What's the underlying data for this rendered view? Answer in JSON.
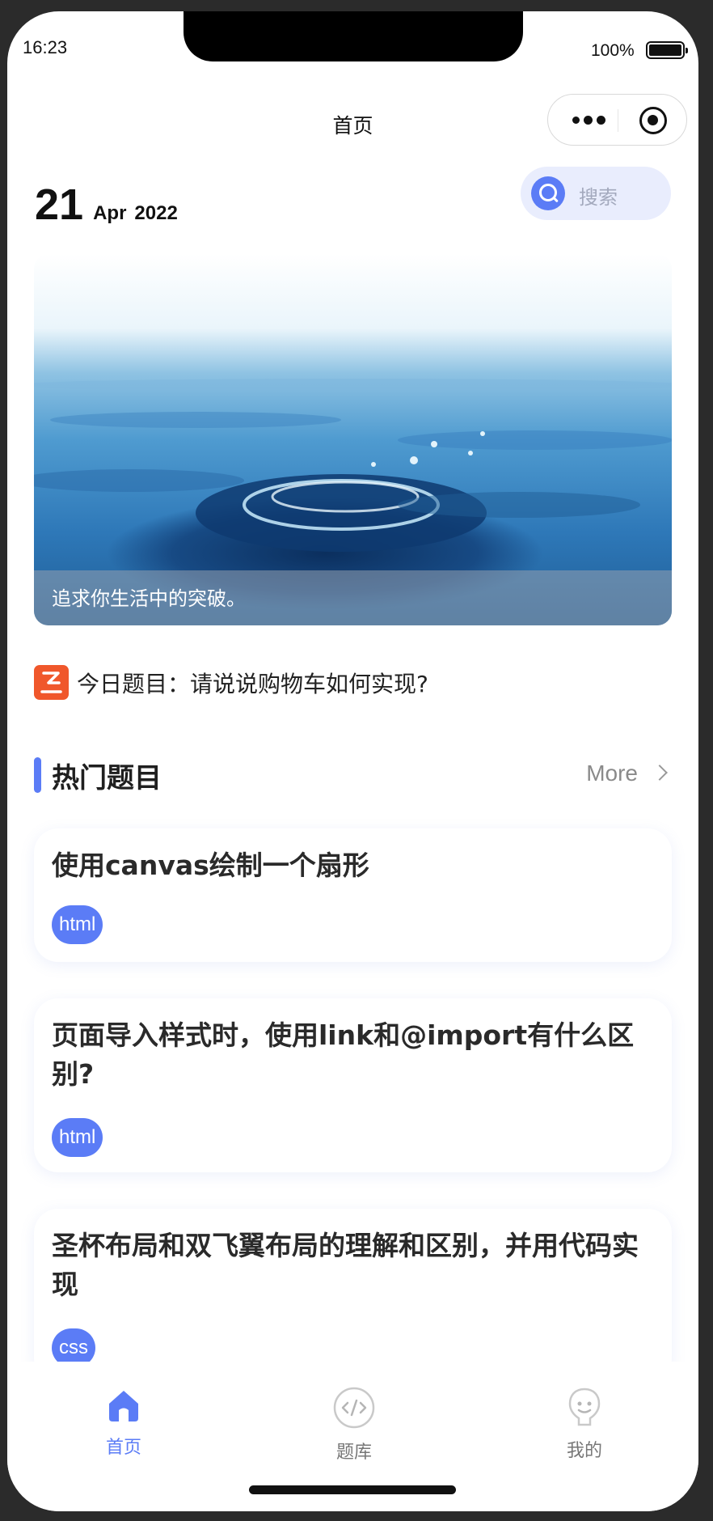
{
  "status_bar": {
    "time": "16:23",
    "battery": "100%"
  },
  "nav": {
    "title": "首页"
  },
  "date": {
    "day": "21",
    "month": "Apr",
    "year": "2022"
  },
  "search": {
    "placeholder": "搜索"
  },
  "banner": {
    "caption": "追求你生活中的突破。"
  },
  "today": {
    "text": "今日题目：请说说购物车如何实现?"
  },
  "hot": {
    "title": "热门题目",
    "more": "More"
  },
  "questions": [
    {
      "title": "使用canvas绘制一个扇形",
      "tag": "html"
    },
    {
      "title": "页面导入样式时，使用link和@import有什么区别?",
      "tag": "html"
    },
    {
      "title": "圣杯布局和双飞翼布局的理解和区别，并用代码实现",
      "tag": "css"
    }
  ],
  "tabs": [
    {
      "label": "首页",
      "icon": "home-icon",
      "active": true
    },
    {
      "label": "题库",
      "icon": "code-icon",
      "active": false
    },
    {
      "label": "我的",
      "icon": "user-icon",
      "active": false
    }
  ],
  "colors": {
    "accent": "#5b7cf6",
    "search_bg": "#e9edfd"
  }
}
